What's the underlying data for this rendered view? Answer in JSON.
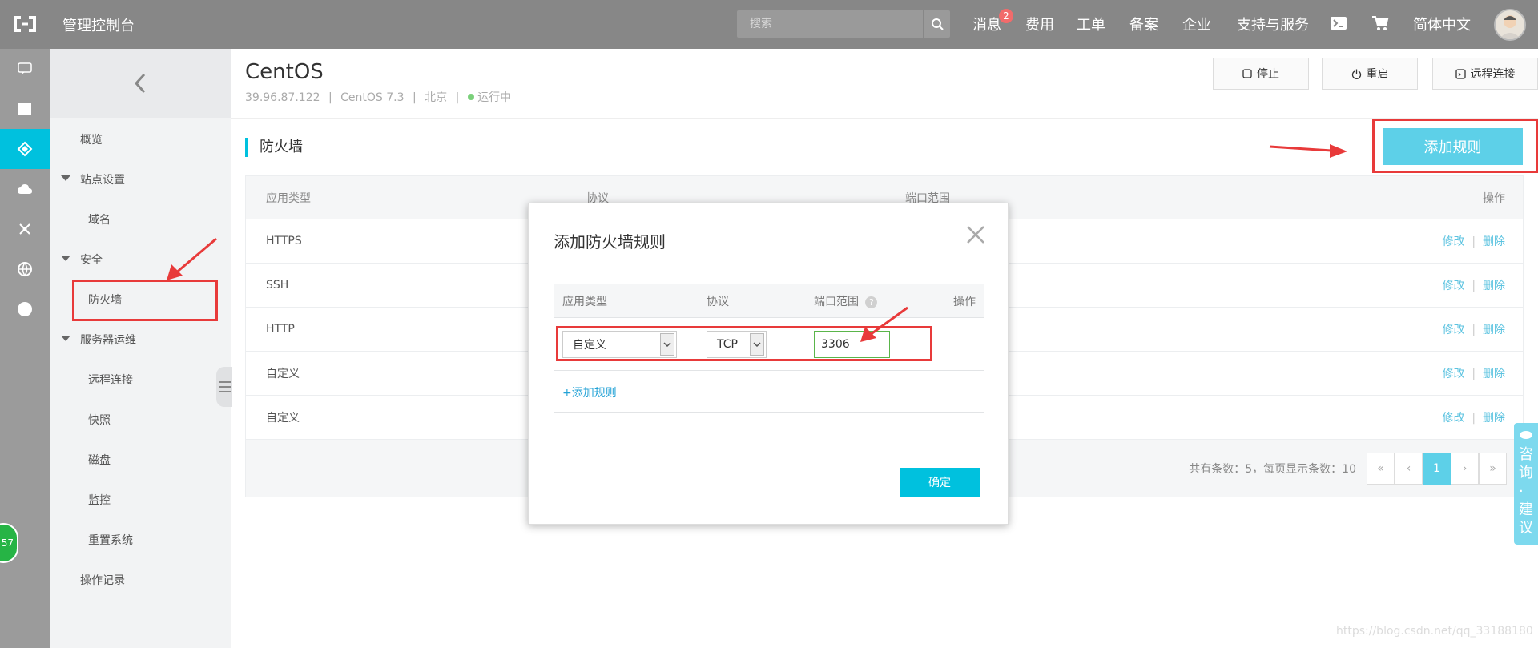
{
  "topbar": {
    "title": "管理控制台",
    "search_placeholder": "搜索",
    "nav": [
      "消息",
      "费用",
      "工单",
      "备案",
      "企业",
      "支持与服务",
      "简体中文"
    ],
    "message_badge": "2"
  },
  "rail": {
    "badge": "57"
  },
  "sidebar": {
    "overview": "概览",
    "site_settings": "站点设置",
    "domain": "域名",
    "security": "安全",
    "firewall": "防火墙",
    "server_ops": "服务器运维",
    "remote": "远程连接",
    "snapshot": "快照",
    "disk": "磁盘",
    "monitor": "监控",
    "reset": "重置系统",
    "oplog": "操作记录"
  },
  "header": {
    "server_name": "CentOS",
    "ip": "39.96.87.122",
    "os": "CentOS 7.3",
    "region": "北京",
    "status": "运行中",
    "stop": "停止",
    "restart": "重启",
    "remote": "远程连接"
  },
  "firewall": {
    "title": "防火墙",
    "add_rule": "添加规则",
    "columns": [
      "应用类型",
      "协议",
      "端口范围",
      "操作"
    ],
    "rows": [
      {
        "app": "HTTPS"
      },
      {
        "app": "SSH"
      },
      {
        "app": "HTTP"
      },
      {
        "app": "自定义"
      },
      {
        "app": "自定义"
      }
    ],
    "edit": "修改",
    "delete": "删除",
    "total_info": "共有条数：5，每页显示条数：10",
    "pagination": [
      "«",
      "‹",
      "1",
      "›",
      "»"
    ]
  },
  "modal": {
    "title": "添加防火墙规则",
    "columns": [
      "应用类型",
      "协议",
      "端口范围",
      "操作"
    ],
    "app_type": "自定义",
    "protocol": "TCP",
    "port": "3306",
    "add_rule_link": "+添加规则",
    "confirm": "确定"
  },
  "consult": "咨询·建议",
  "watermark": "https://blog.csdn.net/qq_33188180",
  "colors": {
    "accent": "#00c1de",
    "annotation": "#e83a3a",
    "topbar": "#878787"
  }
}
